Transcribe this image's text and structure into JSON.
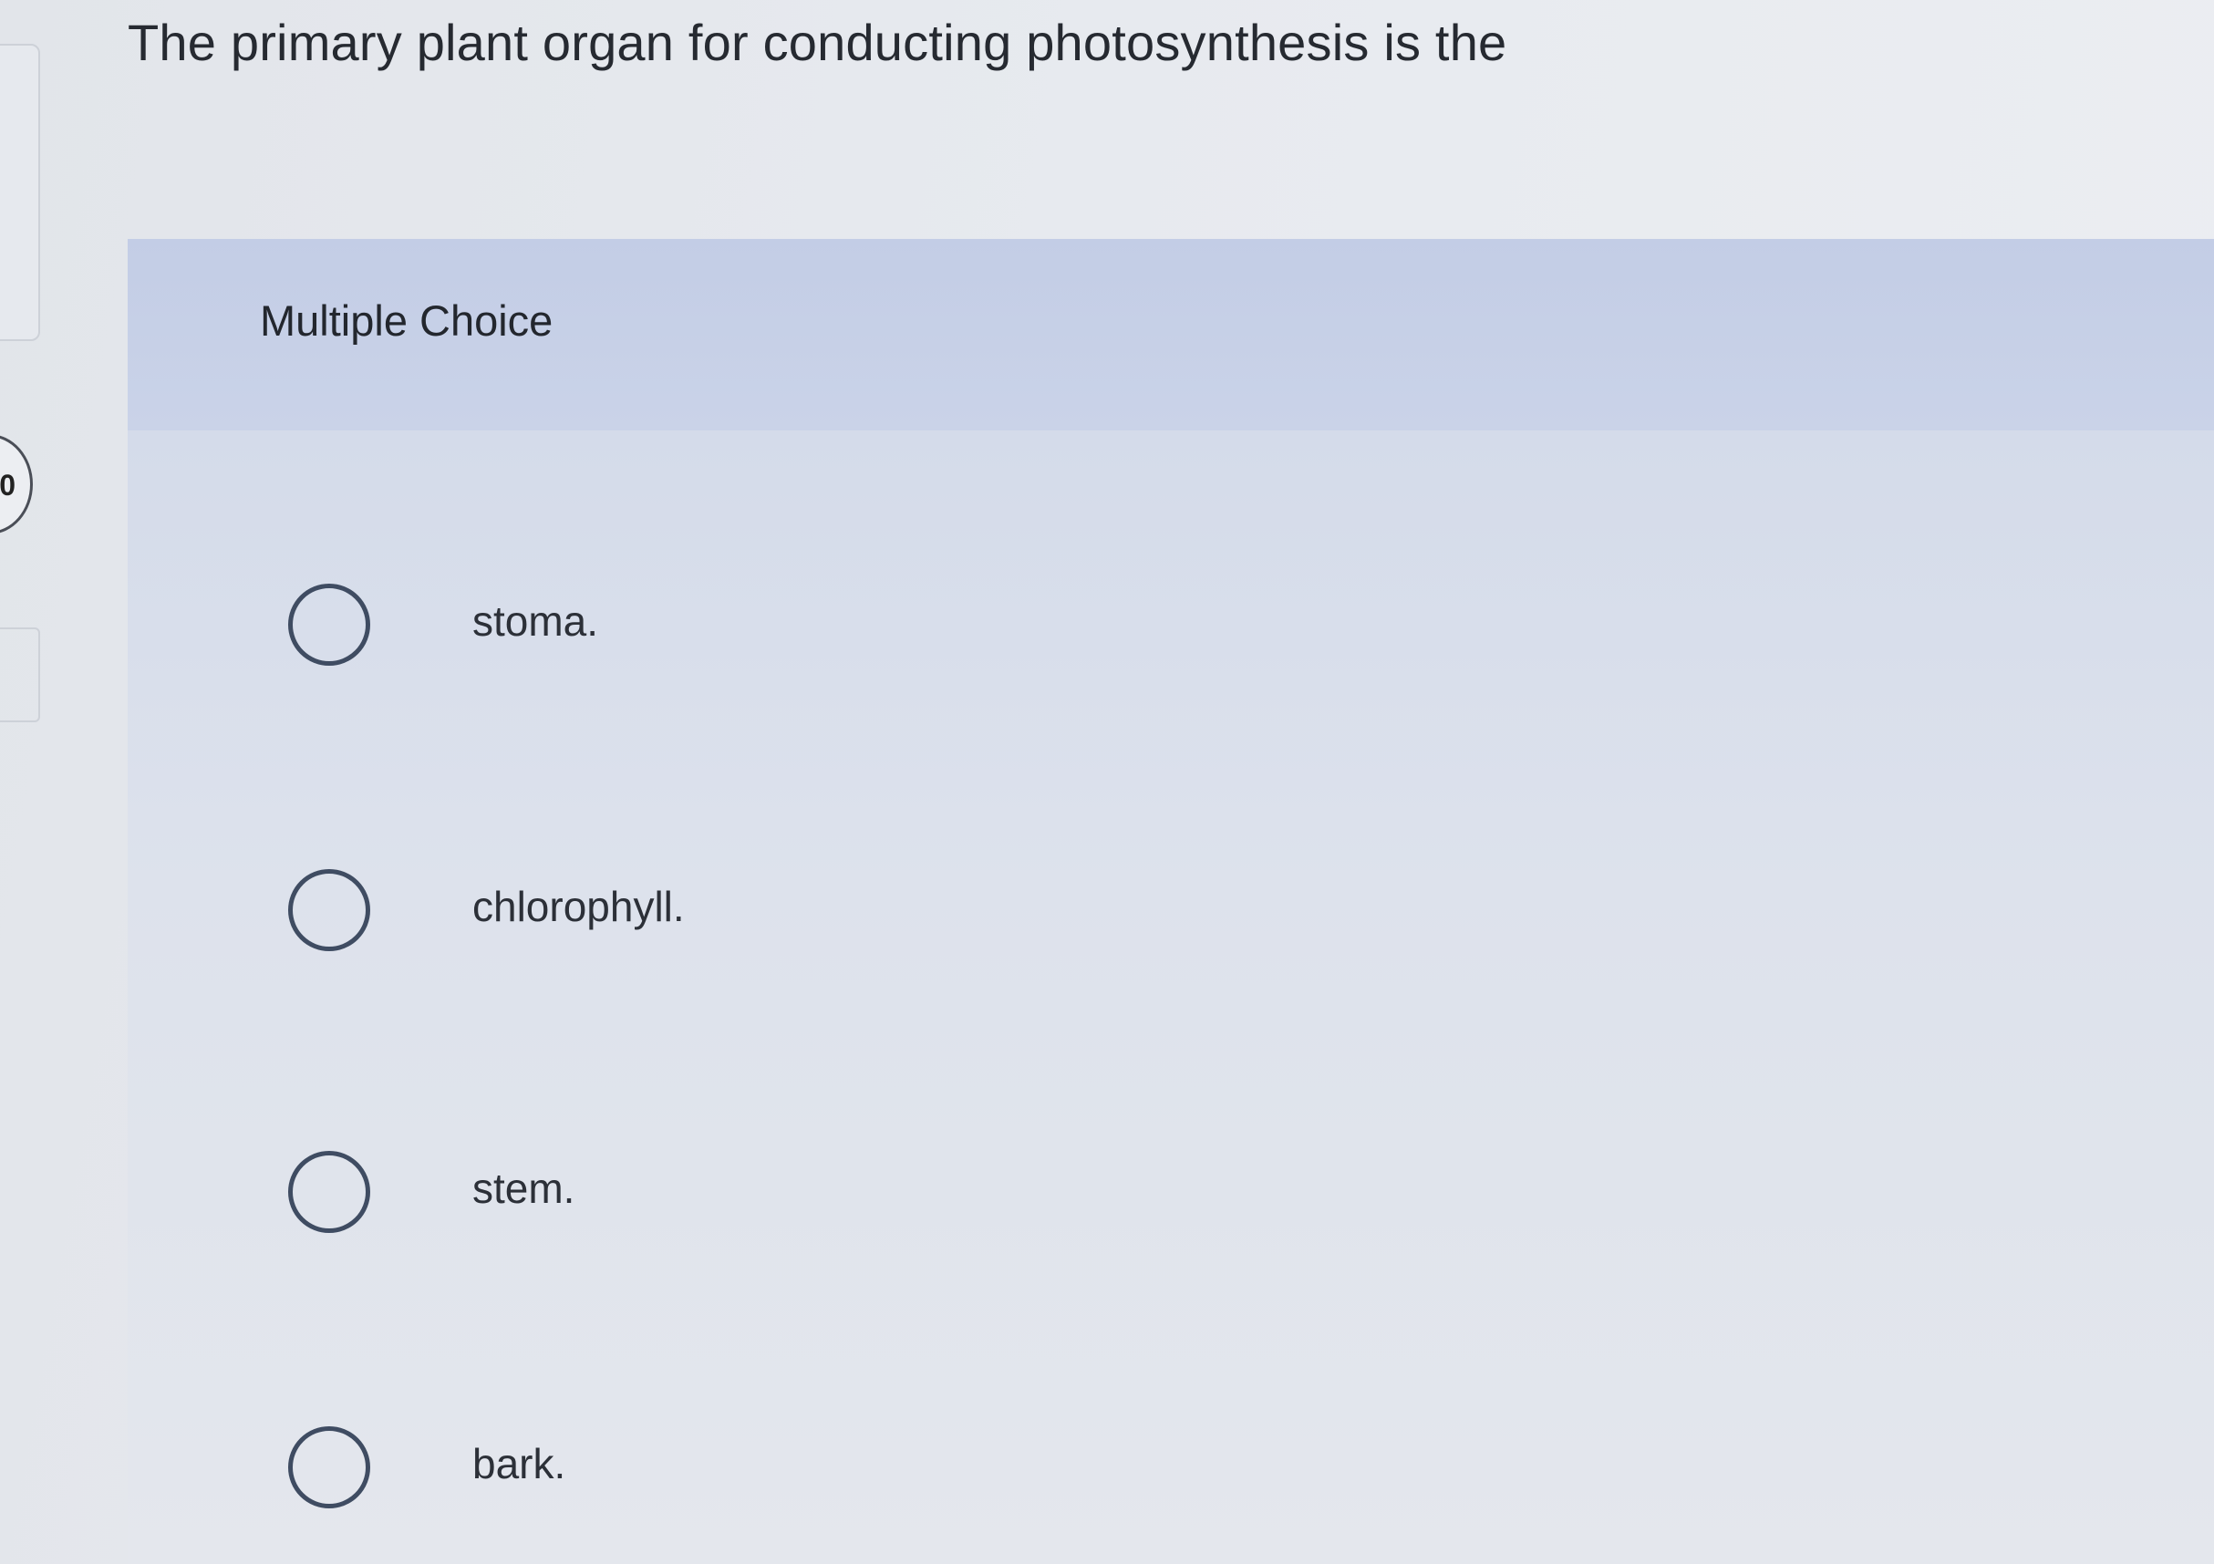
{
  "question": {
    "number": "0",
    "text": "The primary plant organ for conducting photosynthesis is the"
  },
  "multiple_choice": {
    "header": "Multiple Choice",
    "options": [
      {
        "label": "stoma."
      },
      {
        "label": "chlorophyll."
      },
      {
        "label": "stem."
      },
      {
        "label": "bark."
      }
    ]
  },
  "colors": {
    "background": "#e4e7ec",
    "header_band": "#c7d0e7",
    "radio_border": "#3f4c62",
    "text": "#262a31"
  }
}
